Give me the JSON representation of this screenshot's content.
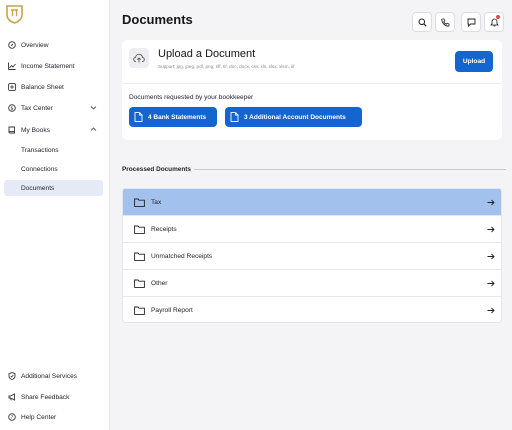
{
  "sidebar": {
    "logo": "shield-logo",
    "items": [
      {
        "label": "Overview",
        "icon": "compass-icon"
      },
      {
        "label": "Income Statement",
        "icon": "trend-icon"
      },
      {
        "label": "Balance Sheet",
        "icon": "scale-icon"
      },
      {
        "label": "Tax Center",
        "icon": "dollar-icon"
      },
      {
        "label": "My Books",
        "icon": "book-icon"
      }
    ],
    "subitems": [
      {
        "label": "Transactions"
      },
      {
        "label": "Connections"
      },
      {
        "label": "Documents"
      }
    ],
    "footer": [
      {
        "label": "Additional Services",
        "icon": "shield-icon"
      },
      {
        "label": "Share Feedback",
        "icon": "megaphone-icon"
      },
      {
        "label": "Help Center",
        "icon": "question-icon"
      }
    ]
  },
  "main": {
    "title": "Documents",
    "upload": {
      "title": "Upload a Document",
      "support": "Support: jpg, jpeg, pdf, png, tiff, tif, doc, docx, csv, xls, xlsx, xlsm, iif",
      "button": "Upload",
      "requested_label": "Documents requested by your bookkeeper",
      "requests": [
        "4 Bank Statements",
        "3 Additional Account Documents"
      ]
    },
    "processed_label": "Processed Documents",
    "folders": [
      "Tax",
      "Receipts",
      "Unmatched Receipts",
      "Other",
      "Payroll Report"
    ]
  },
  "colors": {
    "accent": "#1565d0",
    "selected_row": "#a3c1ed",
    "active_nav": "#e5ebf6",
    "notification": "#e5484d"
  }
}
